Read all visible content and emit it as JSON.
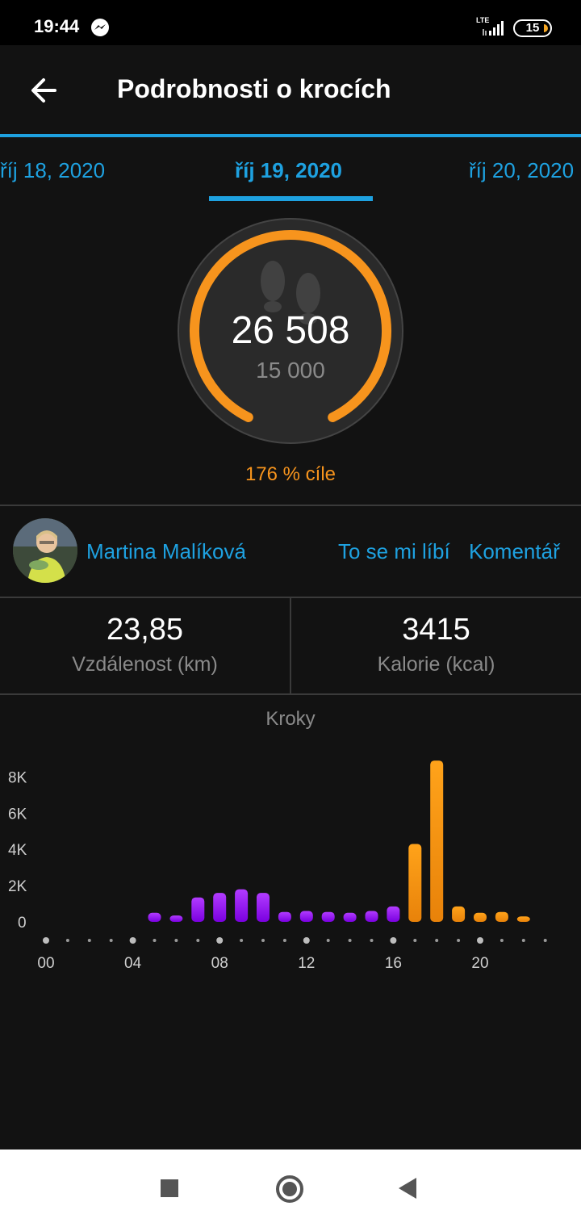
{
  "status_bar": {
    "time": "19:44",
    "network": "LTE",
    "battery": "15"
  },
  "header": {
    "title": "Podrobnosti o krocích"
  },
  "date_tabs": {
    "previous": "říj 18, 2020",
    "current": "říj 19, 2020",
    "next": "říj 20, 2020"
  },
  "steps": {
    "count": "26 508",
    "goal": "15 000",
    "goal_percent_label": "176 % cíle",
    "progress_fraction": 1.0
  },
  "social": {
    "user_name": "Martina Malíková",
    "like_label": "To se mi líbí",
    "comment_label": "Komentář"
  },
  "stats": {
    "distance_value": "23,85",
    "distance_label": "Vzdálenost (km)",
    "calories_value": "3415",
    "calories_label": "Kalorie (kcal)"
  },
  "colors": {
    "accent": "#1ea1e0",
    "goal_orange": "#f7941d",
    "bar_purple": "#a020f0",
    "bar_orange": "#f7941d"
  },
  "chart_data": {
    "type": "bar",
    "title": "Kroky",
    "xlabel": "",
    "ylabel": "",
    "ylim": [
      0,
      9000
    ],
    "y_ticks": [
      "0",
      "2K",
      "4K",
      "6K",
      "8K"
    ],
    "y_tick_values": [
      0,
      2000,
      4000,
      6000,
      8000
    ],
    "x_tick_labels": [
      "00",
      "04",
      "08",
      "12",
      "16",
      "20"
    ],
    "x_tick_hours": [
      0,
      4,
      8,
      12,
      16,
      20
    ],
    "hours": [
      0,
      1,
      2,
      3,
      4,
      5,
      6,
      7,
      8,
      9,
      10,
      11,
      12,
      13,
      14,
      15,
      16,
      17,
      18,
      19,
      20,
      21,
      22,
      23
    ],
    "series": [
      {
        "values": [
          0,
          0,
          0,
          0,
          0,
          500,
          350,
          1350,
          1600,
          1800,
          1600,
          550,
          600,
          550,
          500,
          600,
          850,
          4300,
          8900,
          850,
          500,
          550,
          300,
          0
        ],
        "colors": [
          "purple",
          "purple",
          "purple",
          "purple",
          "purple",
          "purple",
          "purple",
          "purple",
          "purple",
          "purple",
          "purple",
          "purple",
          "purple",
          "purple",
          "purple",
          "purple",
          "purple",
          "orange",
          "orange",
          "orange",
          "orange",
          "orange",
          "orange",
          "orange"
        ]
      }
    ]
  },
  "nav_bar": {
    "recents_icon": "square-icon",
    "home_icon": "circle-icon",
    "back_icon": "triangle-back-icon"
  }
}
